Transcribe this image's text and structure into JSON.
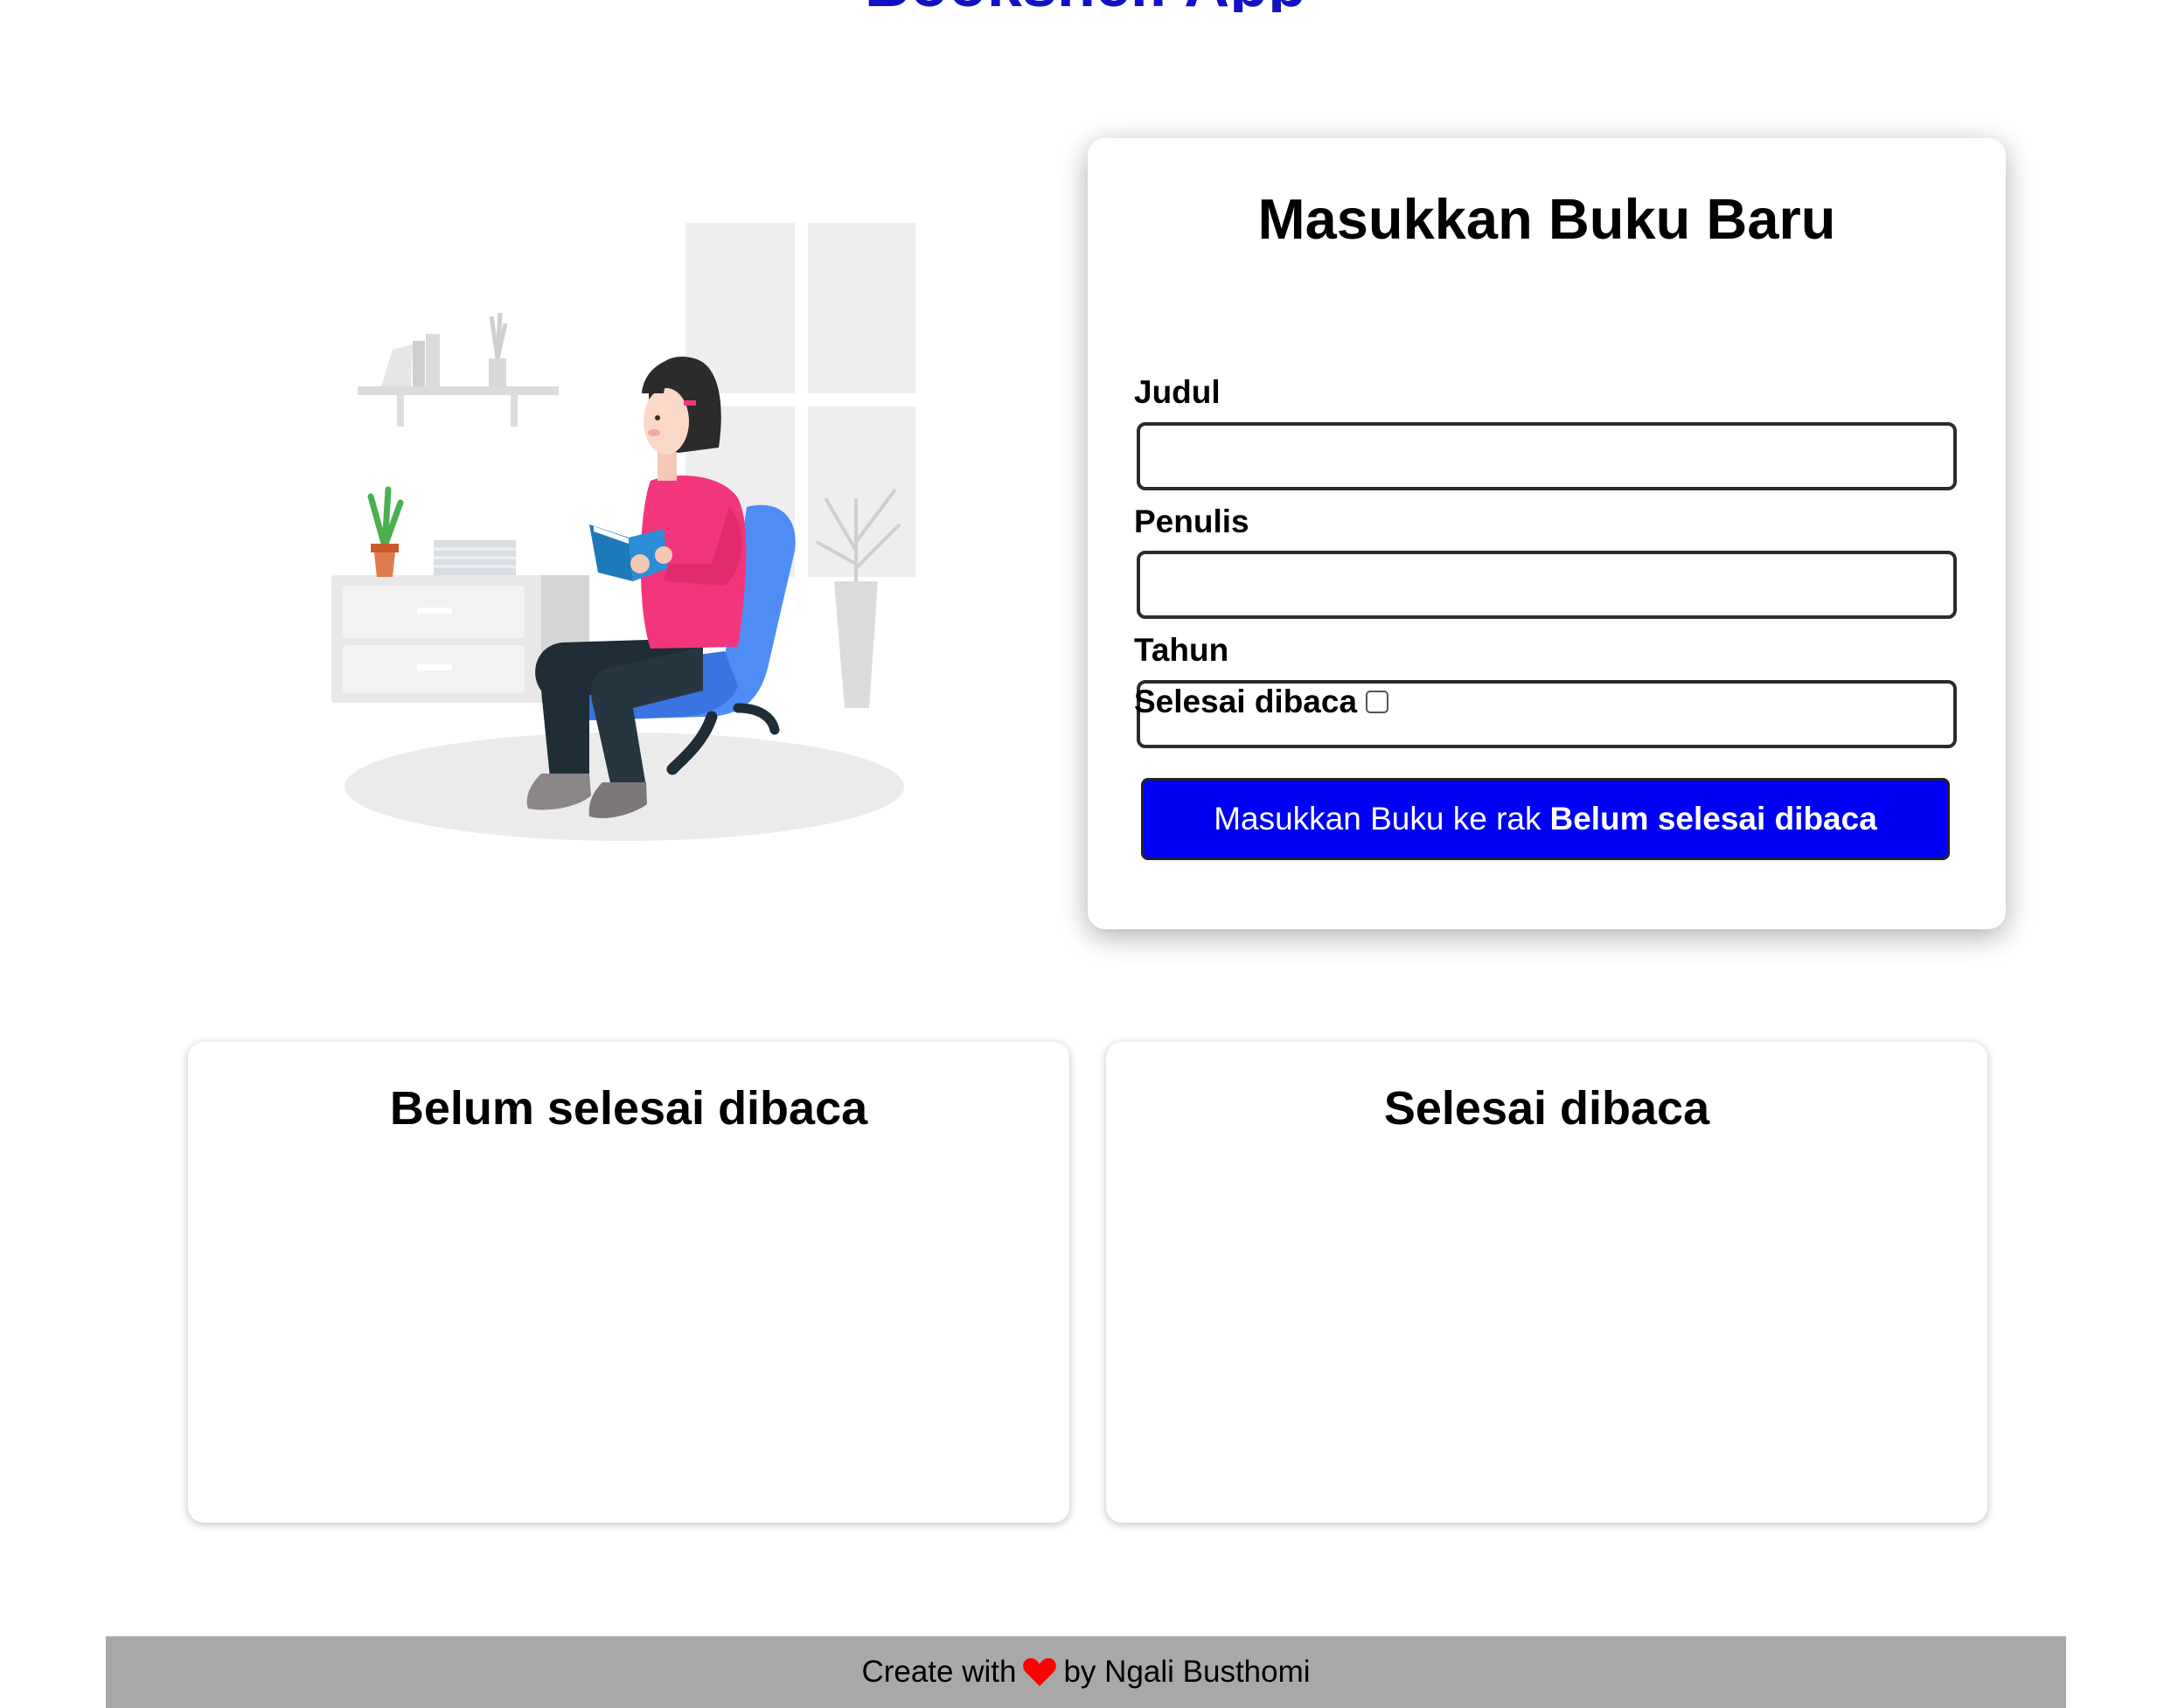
{
  "page": {
    "title": "Bookshelf App"
  },
  "form": {
    "title": "Masukkan Buku Baru",
    "title_label": "Judul",
    "title_value": "",
    "author_label": "Penulis",
    "author_value": "",
    "year_label": "Tahun",
    "year_value": "",
    "complete_label": "Selesai dibaca",
    "complete_checked": false,
    "submit_prefix": "Masukkan Buku ke rak",
    "submit_target": "Belum selesai dibaca"
  },
  "shelves": {
    "incomplete_title": "Belum selesai dibaca",
    "complete_title": "Selesai dibaca"
  },
  "footer": {
    "prefix": "Create with",
    "suffix": "by Ngali Busthomi",
    "icon": "heart-icon"
  },
  "colors": {
    "title": "#1212c4",
    "button": "#0000f5",
    "footer": "#a8a8a8",
    "heart": "#ff0000",
    "shirt": "#f2357d",
    "chair": "#4f8df5"
  }
}
